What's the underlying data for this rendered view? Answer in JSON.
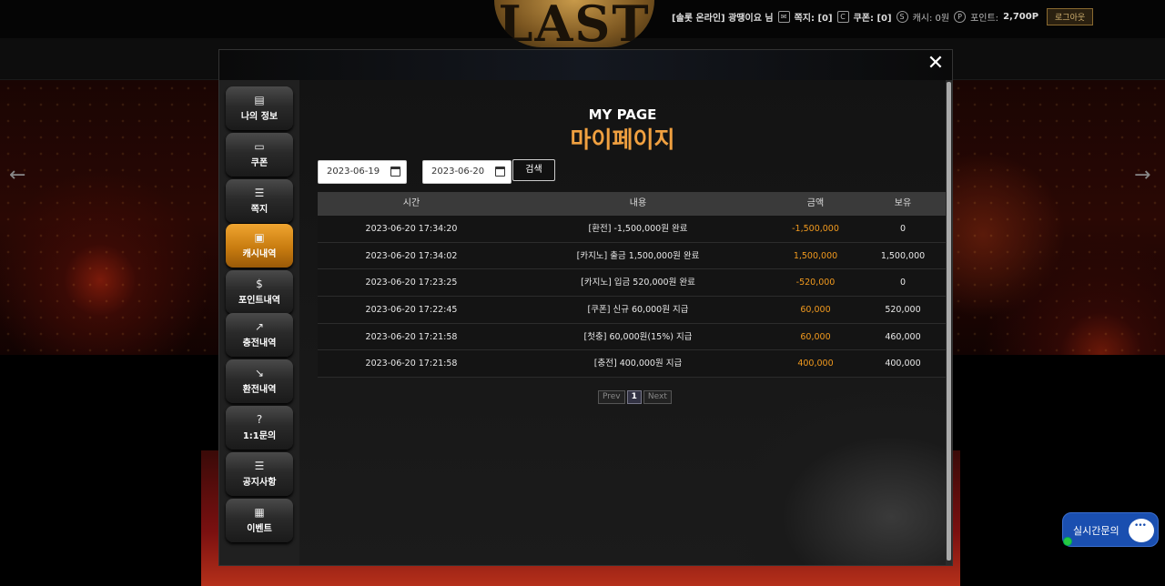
{
  "header": {
    "logo_text": "LAST",
    "user_greeting": "[솔롯 온라인] 광땡이요 님",
    "messages": "쪽지: [0]",
    "coupons": "쿠폰: [0]",
    "cash": "캐시: 0원",
    "points_label": "포인트:",
    "points_value": "2,700P",
    "logout_label": "로그아웃"
  },
  "modal": {
    "close_label": "✕",
    "title_en": "MY PAGE",
    "title_ko": "마이페이지"
  },
  "sidebar": {
    "items": [
      {
        "label": "나의 정보",
        "icon": "id-card-icon"
      },
      {
        "label": "쿠폰",
        "icon": "coupon-icon"
      },
      {
        "label": "쪽지",
        "icon": "message-icon"
      },
      {
        "label": "캐시내역",
        "icon": "cash-icon"
      },
      {
        "label": "포인트내역",
        "icon": "money-bag-icon"
      },
      {
        "label": "충전내역",
        "icon": "chart-up-icon"
      },
      {
        "label": "환전내역",
        "icon": "chart-down-icon"
      },
      {
        "label": "1:1문의",
        "icon": "question-icon"
      },
      {
        "label": "공지사항",
        "icon": "notice-icon"
      },
      {
        "label": "이벤트",
        "icon": "calendar-icon"
      }
    ]
  },
  "filter": {
    "start_date": "2023-06-19",
    "end_date": "2023-06-20",
    "search_label": "검색"
  },
  "table": {
    "headers": [
      "시간",
      "내용",
      "금액",
      "보유"
    ],
    "rows": [
      {
        "time": "2023-06-20 17:34:20",
        "content": "[환전] -1,500,000원 완료",
        "amount": "-1,500,000",
        "balance": "0"
      },
      {
        "time": "2023-06-20 17:34:02",
        "content": "[카지노] 출금 1,500,000원 완료",
        "amount": "1,500,000",
        "balance": "1,500,000"
      },
      {
        "time": "2023-06-20 17:23:25",
        "content": "[카지노] 입금 520,000원 완료",
        "amount": "-520,000",
        "balance": "0"
      },
      {
        "time": "2023-06-20 17:22:45",
        "content": "[쿠폰] 신규 60,000원 지급",
        "amount": "60,000",
        "balance": "520,000"
      },
      {
        "time": "2023-06-20 17:21:58",
        "content": "[첫충] 60,000원(15%) 지급",
        "amount": "60,000",
        "balance": "460,000"
      },
      {
        "time": "2023-06-20 17:21:58",
        "content": "[충전] 400,000원 지급",
        "amount": "400,000",
        "balance": "400,000"
      }
    ]
  },
  "pagination": {
    "prev": "Prev",
    "current": "1",
    "next": "Next"
  },
  "chat": {
    "label": "실시간문의"
  },
  "colors": {
    "accent": "#f0a040",
    "amount": "#f29a1e",
    "active_tab": "#e09020"
  }
}
